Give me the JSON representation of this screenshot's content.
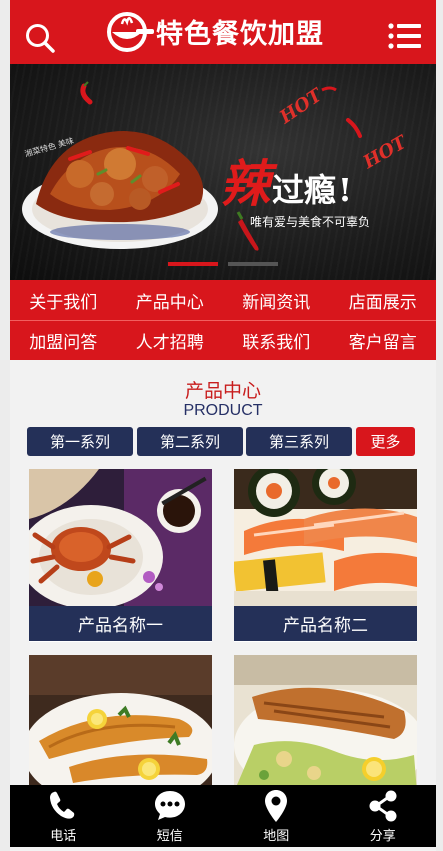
{
  "header": {
    "title": "特色餐饮加盟",
    "search_icon": "search-icon",
    "menu_icon": "menu-icon",
    "brand_color": "#d8161c"
  },
  "banner": {
    "slogan_big": "辣",
    "slogan_rest": "过瘾",
    "slogan_mark": "!",
    "subtitle": "唯有爱与美食不可辜负",
    "hot_text_1": "HOT",
    "hot_text_2": "HOT",
    "dish_caption": "湘菜特色 美味",
    "slide_count": 2,
    "active_slide": 1
  },
  "nav": {
    "row1": [
      "关于我们",
      "产品中心",
      "新闻资讯",
      "店面展示"
    ],
    "row2": [
      "加盟问答",
      "人才招聘",
      "联系我们",
      "客户留言"
    ]
  },
  "products": {
    "title": "产品中心",
    "subtitle": "PRODUCT",
    "tabs": [
      "第一系列",
      "第二系列",
      "第三系列"
    ],
    "more_label": "更多",
    "items": [
      {
        "name": "产品名称一"
      },
      {
        "name": "产品名称二"
      },
      {
        "name": "",
        "image": "fried-fish-fillet"
      },
      {
        "name": "",
        "image": "grilled-fish-salad"
      }
    ],
    "card_title_color": "#243058"
  },
  "bottom_bar": {
    "items": [
      {
        "label": "电话",
        "icon": "phone-icon"
      },
      {
        "label": "短信",
        "icon": "message-icon"
      },
      {
        "label": "地图",
        "icon": "map-pin-icon"
      },
      {
        "label": "分享",
        "icon": "share-icon"
      }
    ]
  }
}
